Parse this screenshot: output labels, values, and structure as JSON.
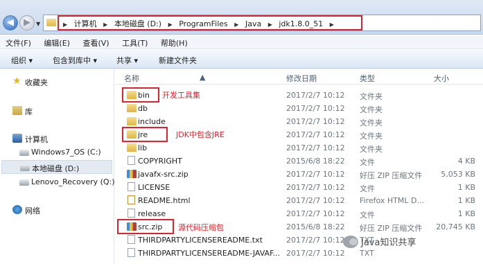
{
  "address": {
    "crumbs": [
      "计算机",
      "本地磁盘 (D:)",
      "ProgramFiles",
      "Java",
      "jdk1.8.0_51"
    ]
  },
  "menubar": [
    "文件(F)",
    "编辑(E)",
    "查看(V)",
    "工具(T)",
    "帮助(H)"
  ],
  "toolbar": {
    "organize": "组织 ▾",
    "include": "包含到库中 ▾",
    "share": "共享 ▾",
    "new_folder": "新建文件夹"
  },
  "nav": {
    "favorites": "收藏夹",
    "library": "库",
    "computer": "计算机",
    "drive_c": "Windows7_OS (C:)",
    "drive_d": "本地磁盘 (D:)",
    "drive_q": "Lenovo_Recovery (Q:)",
    "network": "网络"
  },
  "columns": {
    "name": "名称",
    "date": "修改日期",
    "type": "类型",
    "size": "大小"
  },
  "files": [
    {
      "name": "bin",
      "date": "2017/2/7 10:12",
      "type": "文件夹",
      "size": "",
      "icon": "folder"
    },
    {
      "name": "db",
      "date": "2017/2/7 10:12",
      "type": "文件夹",
      "size": "",
      "icon": "folder"
    },
    {
      "name": "include",
      "date": "2017/2/7 10:12",
      "type": "文件夹",
      "size": "",
      "icon": "folder"
    },
    {
      "name": "jre",
      "date": "2017/2/7 10:12",
      "type": "文件夹",
      "size": "",
      "icon": "folder"
    },
    {
      "name": "lib",
      "date": "2017/2/7 10:12",
      "type": "文件夹",
      "size": "",
      "icon": "folder"
    },
    {
      "name": "COPYRIGHT",
      "date": "2015/6/8 18:22",
      "type": "文件",
      "size": "4 KB",
      "icon": "file"
    },
    {
      "name": "javafx-src.zip",
      "date": "2017/2/7 10:12",
      "type": "好压 ZIP 压缩文件",
      "size": "5,053 KB",
      "icon": "zip"
    },
    {
      "name": "LICENSE",
      "date": "2017/2/7 10:12",
      "type": "文件",
      "size": "1 KB",
      "icon": "file"
    },
    {
      "name": "README.html",
      "date": "2017/2/7 10:12",
      "type": "Firefox HTML D...",
      "size": "1 KB",
      "icon": "html"
    },
    {
      "name": "release",
      "date": "2017/2/7 10:12",
      "type": "文件",
      "size": "1 KB",
      "icon": "file"
    },
    {
      "name": "src.zip",
      "date": "2015/6/8 18:22",
      "type": "好压 ZIP 压缩文件",
      "size": "20,745 KB",
      "icon": "zip"
    },
    {
      "name": "THIRDPARTYLICENSEREADME.txt",
      "date": "2017/2/7 10:12",
      "type": "TXT",
      "size": "",
      "icon": "file"
    },
    {
      "name": "THIRDPARTYLICENSEREADME-JAVAF...",
      "date": "2017/2/7 10:12",
      "type": "TXT",
      "size": "",
      "icon": "file"
    }
  ],
  "annotations": {
    "bin": "开发工具集",
    "jre": "JDK中包含JRE",
    "src": "源代码压缩包"
  },
  "watermark": "Java知识共享",
  "colors": {
    "highlight": "#e3202b",
    "folder": "#e2b94b",
    "selection": "#e4eaf2"
  }
}
